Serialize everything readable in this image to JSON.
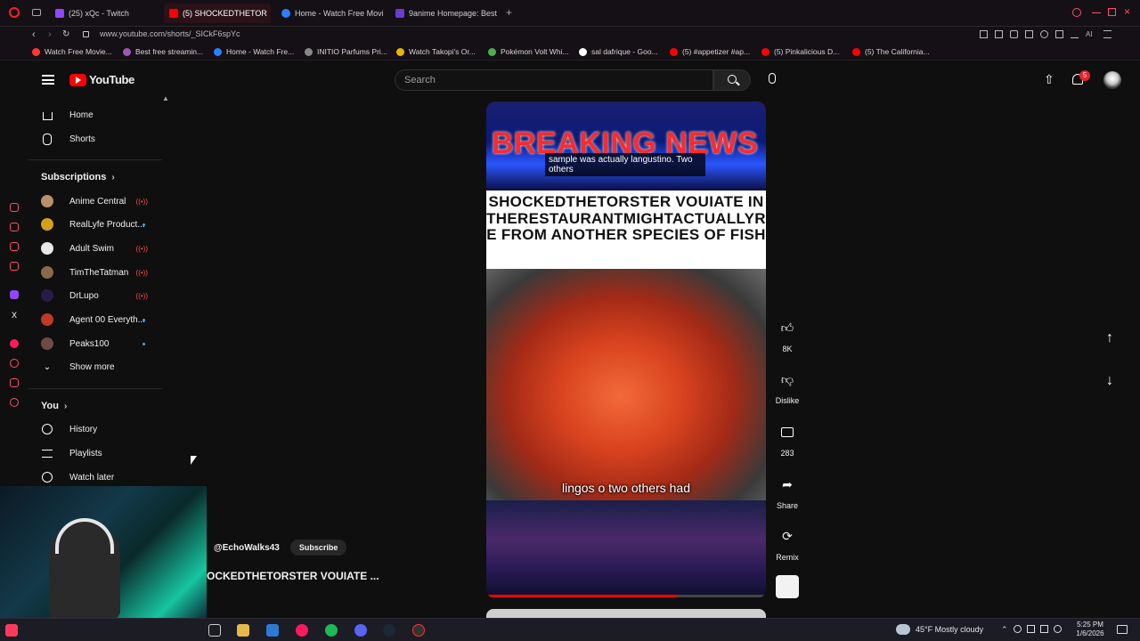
{
  "browser": {
    "tabs": [
      {
        "label": "(25) xQc - Twitch",
        "active": false
      },
      {
        "label": "(5) SHOCKEDTHETOR",
        "active": true
      },
      {
        "label": "Home - Watch Free Movie",
        "active": false
      },
      {
        "label": "9anime Homepage: Best f",
        "active": false
      }
    ],
    "url": "www.youtube.com/shorts/_SICkF6spYc",
    "bookmarks": [
      "Watch Free Movie...",
      "Best free streamin...",
      "Home - Watch Fre...",
      "INITIO Parfums Pri...",
      "Watch Takopi's Or...",
      "Pokémon Volt Whi...",
      "sal dafrique - Goo...",
      "(5) #appetizer #ap...",
      "(5) Pinkalicious D...",
      "(5) The California..."
    ]
  },
  "youtube": {
    "logo_text": "YouTube",
    "search_placeholder": "Search",
    "notification_count": "5",
    "sidebar": {
      "home": "Home",
      "shorts": "Shorts",
      "subscriptions_title": "Subscriptions",
      "subscriptions": [
        {
          "name": "Anime Central",
          "status": "live"
        },
        {
          "name": "RealLyfe Product...",
          "status": "new"
        },
        {
          "name": "Adult Swim",
          "status": "live"
        },
        {
          "name": "TimTheTatman",
          "status": "live"
        },
        {
          "name": "DrLupo",
          "status": "live"
        },
        {
          "name": "Agent 00 Everyth...",
          "status": "new"
        },
        {
          "name": "Peaks100",
          "status": "new"
        }
      ],
      "show_more": "Show more",
      "you_title": "You",
      "history": "History",
      "playlists": "Playlists",
      "watch_later": "Watch later"
    },
    "short": {
      "breaking_text": "BREAKING NEWS",
      "caption_overlay": "sample was actually langustino. Two others",
      "headline": "SHOCKEDTHETORSTER VOUIATE INTHERESTAURANTMIGHTACTUALLYRE FROM ANOTHER SPECIES OF FISH",
      "subtitle": "lingos o two others had",
      "channel": "@EchoWalks43",
      "subscribe_label": "Subscribe",
      "title": "OCKEDTHETORSTER VOUIATE ..."
    },
    "actions": {
      "likes": "8K",
      "dislike": "Dislike",
      "comments": "283",
      "share": "Share",
      "remix": "Remix"
    }
  },
  "taskbar": {
    "weather": "45°F Mostly cloudy",
    "time": "5:25 PM",
    "date": "1/6/2026"
  }
}
